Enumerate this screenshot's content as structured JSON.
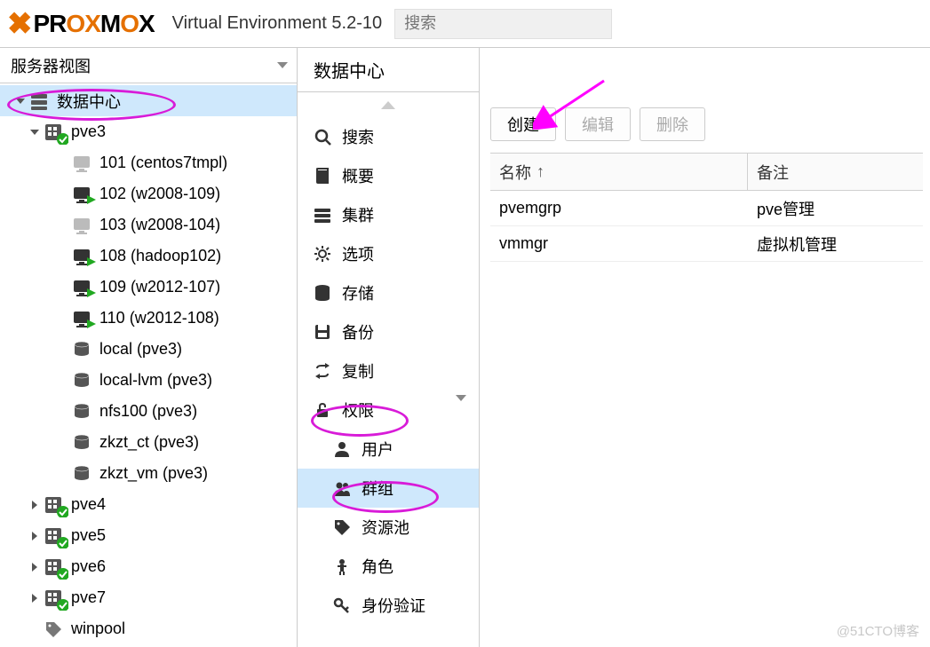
{
  "header": {
    "product": "PROXMOX",
    "env_label": "Virtual Environment 5.2-10",
    "search_placeholder": "搜索"
  },
  "sidebar": {
    "view_label": "服务器视图",
    "tree": {
      "datacenter": "数据中心",
      "nodes": [
        {
          "name": "pve3",
          "expanded": true,
          "children_vm": [
            {
              "id": "101",
              "label": "101 (centos7tmpl)",
              "running": false,
              "template": true
            },
            {
              "id": "102",
              "label": "102 (w2008-109)",
              "running": true
            },
            {
              "id": "103",
              "label": "103 (w2008-104)",
              "running": false,
              "template": true
            },
            {
              "id": "108",
              "label": "108 (hadoop102)",
              "running": true
            },
            {
              "id": "109",
              "label": "109 (w2012-107)",
              "running": true
            },
            {
              "id": "110",
              "label": "110 (w2012-108)",
              "running": true
            }
          ],
          "children_storage": [
            {
              "label": "local (pve3)"
            },
            {
              "label": "local-lvm (pve3)"
            },
            {
              "label": "nfs100 (pve3)"
            },
            {
              "label": "zkzt_ct (pve3)"
            },
            {
              "label": "zkzt_vm (pve3)"
            }
          ]
        },
        {
          "name": "pve4",
          "expanded": false
        },
        {
          "name": "pve5",
          "expanded": false
        },
        {
          "name": "pve6",
          "expanded": false
        },
        {
          "name": "pve7",
          "expanded": false
        }
      ],
      "pool": "winpool"
    }
  },
  "mid": {
    "title": "数据中心",
    "items": {
      "search": "搜索",
      "summary": "概要",
      "cluster": "集群",
      "options": "选项",
      "storage": "存储",
      "backup": "备份",
      "replication": "复制",
      "permissions": "权限",
      "users": "用户",
      "groups": "群组",
      "pools": "资源池",
      "roles": "角色",
      "auth": "身份验证"
    }
  },
  "right": {
    "buttons": {
      "create": "创建",
      "edit": "编辑",
      "delete": "删除"
    },
    "columns": {
      "name": "名称",
      "note": "备注"
    },
    "rows": [
      {
        "name": "pvemgrp",
        "note": "pve管理"
      },
      {
        "name": "vmmgr",
        "note": "虚拟机管理"
      }
    ]
  },
  "watermark": "@51CTO博客"
}
